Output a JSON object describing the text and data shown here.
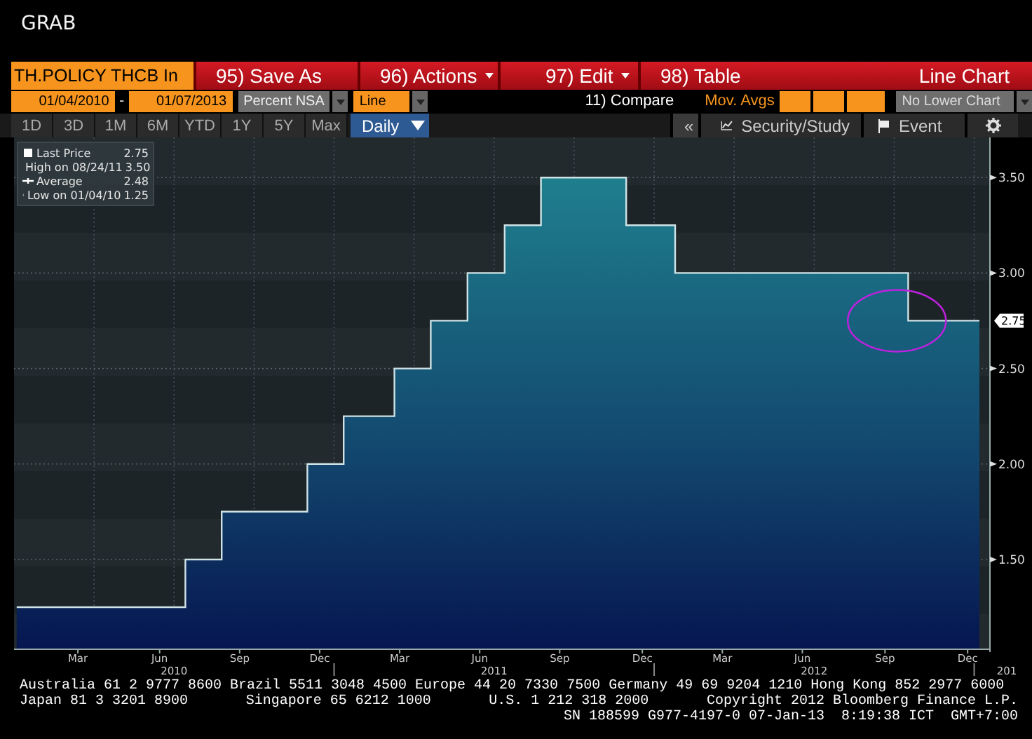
{
  "window": {
    "title": "GRAB"
  },
  "toolbar": {
    "security": "TH.POLICY THCB In",
    "actions": [
      {
        "label": "95) Save As",
        "dropdown": false
      },
      {
        "label": "96) Actions",
        "dropdown": true
      },
      {
        "label": "97) Edit",
        "dropdown": true
      },
      {
        "label": "98) Table",
        "dropdown": false
      }
    ],
    "view": "Line Chart"
  },
  "settings": {
    "start_date": "01/04/2010",
    "separator": "-",
    "end_date": "01/07/2013",
    "units": "Percent NSA",
    "chart_type": "Line",
    "compare": "11) Compare",
    "moving_averages": "Mov. Avgs",
    "lower_chart": "No Lower Chart"
  },
  "periods": [
    {
      "label": "1D",
      "selected": false
    },
    {
      "label": "3D",
      "selected": false
    },
    {
      "label": "1M",
      "selected": false
    },
    {
      "label": "6M",
      "selected": false
    },
    {
      "label": "YTD",
      "selected": false
    },
    {
      "label": "1Y",
      "selected": false
    },
    {
      "label": "5Y",
      "selected": false
    },
    {
      "label": "Max",
      "selected": false
    }
  ],
  "frequency": "Daily",
  "tools": {
    "collapse": "«",
    "study": "Security/Study",
    "event": "Event"
  },
  "legend": [
    {
      "kind": "last",
      "value": "2.75"
    },
    {
      "kind": "high",
      "label": "High on 08/24/11",
      "value": "3.50"
    },
    {
      "kind": "average",
      "label": "Average",
      "value": "2.48"
    },
    {
      "kind": "low",
      "label": "Low on 01/04/10",
      "value": "1.25"
    }
  ],
  "chart_data": {
    "type": "area",
    "x": [
      "2010-01-04",
      "2010-07-14",
      "2010-07-14",
      "2010-08-25",
      "2010-08-25",
      "2010-12-01",
      "2010-12-01",
      "2011-01-12",
      "2011-01-12",
      "2011-03-09",
      "2011-03-09",
      "2011-04-20",
      "2011-04-20",
      "2011-06-01",
      "2011-06-01",
      "2011-07-13",
      "2011-07-13",
      "2011-08-24",
      "2011-08-24",
      "2011-11-30",
      "2011-11-30",
      "2012-01-25",
      "2012-01-25",
      "2012-10-17",
      "2012-10-17",
      "2013-01-07"
    ],
    "series": [
      {
        "name": "Last Price",
        "color": "#cfe3e6",
        "values": [
          1.25,
          1.25,
          1.5,
          1.5,
          1.75,
          1.75,
          2,
          2,
          2.25,
          2.25,
          2.5,
          2.5,
          2.75,
          2.75,
          3,
          3,
          3.25,
          3.25,
          3.5,
          3.5,
          3.25,
          3.25,
          3,
          3,
          2.75,
          2.75
        ]
      }
    ],
    "xlim": [
      "2010-01-01",
      "2013-01-19"
    ],
    "ylim": [
      1.03,
      3.71
    ],
    "grid": true,
    "xticks": [
      {
        "value": "2010-03-13",
        "label": "Mar"
      },
      {
        "value": "2010-06-15",
        "label": "Jun"
      },
      {
        "value": "2010-09-15",
        "label": "Sep"
      },
      {
        "value": "2010-12-15",
        "label": "Dec"
      },
      {
        "value": "2011-03-15",
        "label": "Mar"
      },
      {
        "value": "2011-06-15",
        "label": "Jun"
      },
      {
        "value": "2011-09-15",
        "label": "Sep"
      },
      {
        "value": "2011-12-18",
        "label": "Dec"
      },
      {
        "value": "2012-03-18",
        "label": "Mar"
      },
      {
        "value": "2012-06-18",
        "label": "Jun"
      },
      {
        "value": "2012-09-21",
        "label": "Sep"
      },
      {
        "value": "2012-12-24",
        "label": "Dec"
      }
    ],
    "yticks": [
      {
        "value": 1.5,
        "label": "1.50"
      },
      {
        "value": 2,
        "label": "2.00"
      },
      {
        "value": 2.5,
        "label": "2.50"
      },
      {
        "value": 3,
        "label": "3.00"
      },
      {
        "value": 3.5,
        "label": "3.50"
      }
    ]
  },
  "year_labels": [
    "2010",
    "2011",
    "2012",
    "201"
  ],
  "last_price_tag": "2.75",
  "footer": {
    "line_1": "Australia 61 2 9777 8600 Brazil 5511 3048 4500 Europe 44 20 7330 7500 Germany 49 69 9204 1210 Hong Kong 852 2977 6000",
    "line_2": [
      "Japan 81 3 3201 8900",
      "Singapore 65 6212 1000",
      "U.S. 1 212 318 2000",
      "Copyright 2012 Bloomberg Finance L.P."
    ],
    "line_3": "SN 188599 G977-4197-0 07-Jan-13  8:19:38 ICT  GMT+7:00"
  }
}
